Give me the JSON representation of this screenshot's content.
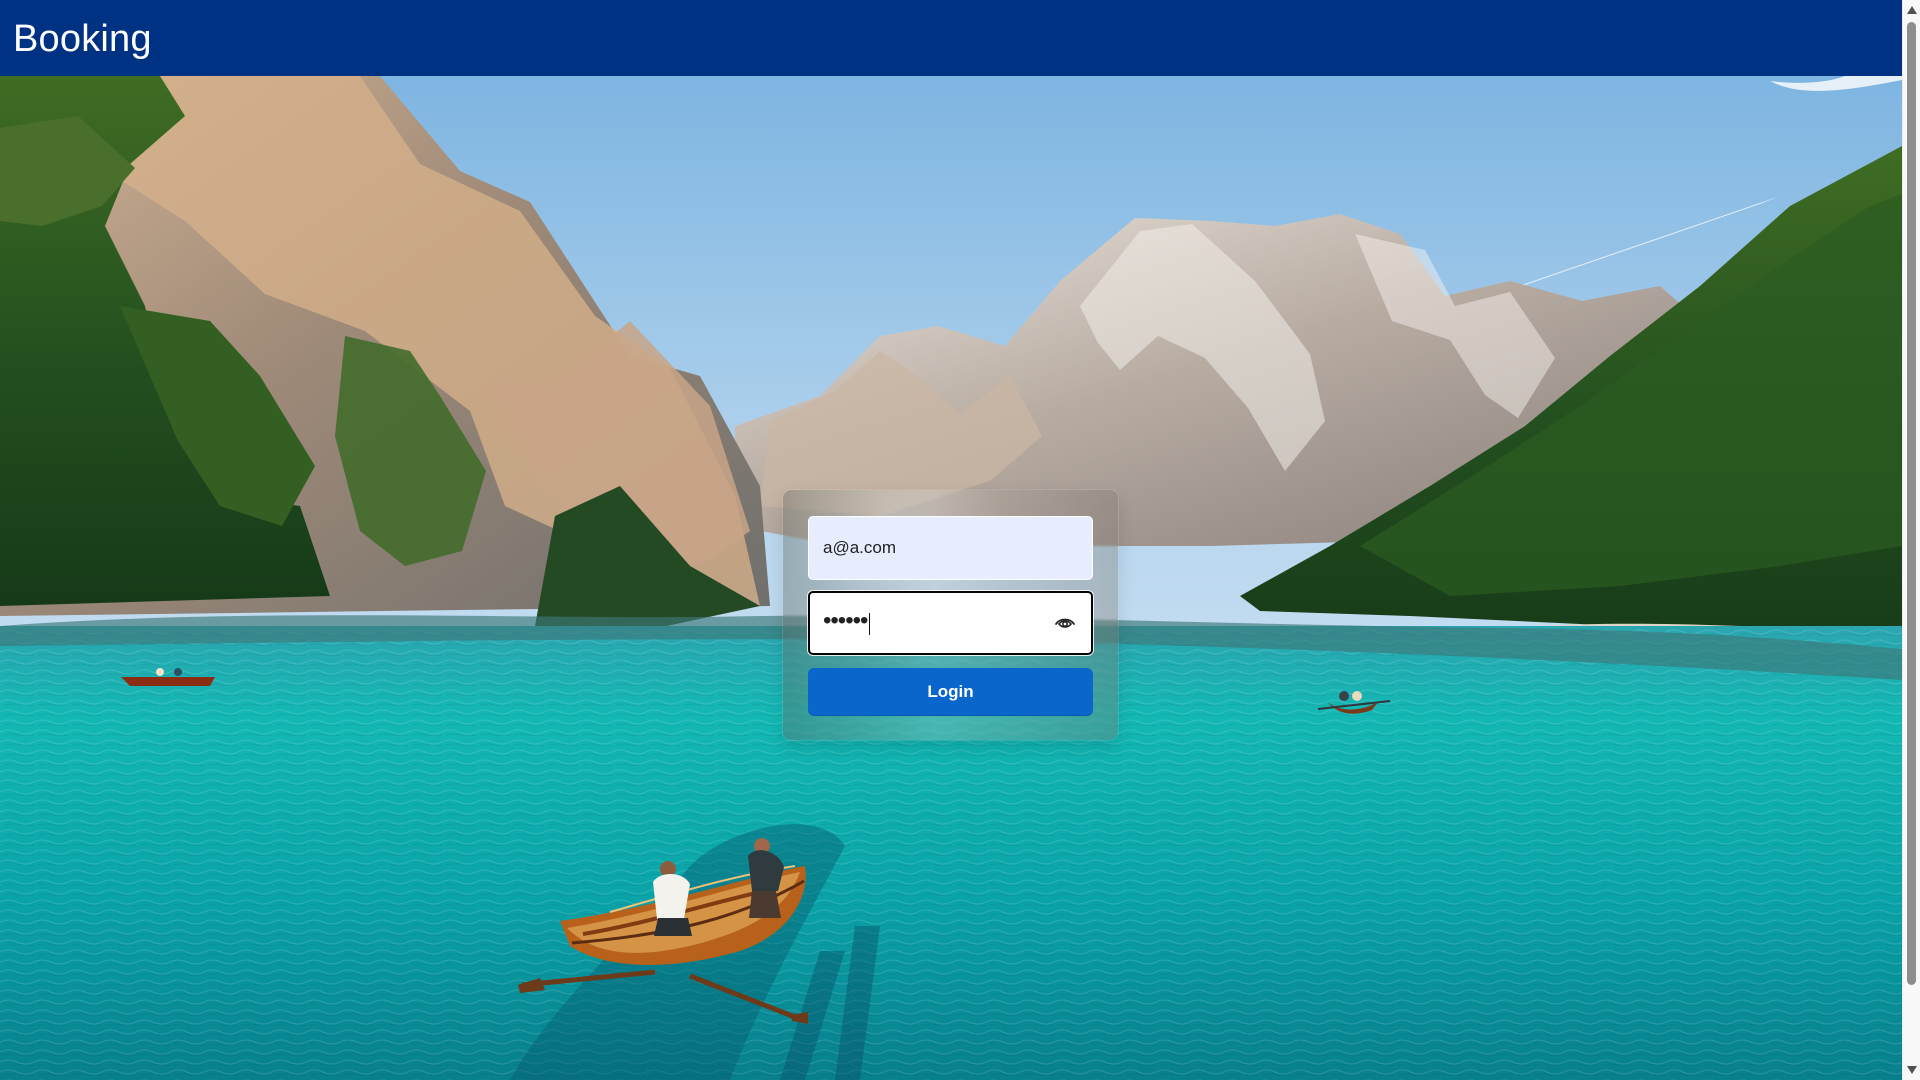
{
  "header": {
    "title": "Booking"
  },
  "login": {
    "email_value": "a@a.com",
    "password_masked": "••••••",
    "show_password_icon": "eye-icon",
    "button_label": "Login"
  },
  "background": {
    "image": "mountain lake with boats"
  },
  "colors": {
    "header": "#003283",
    "primary_button": "#0b66cc",
    "email_field": "#e8edfd"
  }
}
